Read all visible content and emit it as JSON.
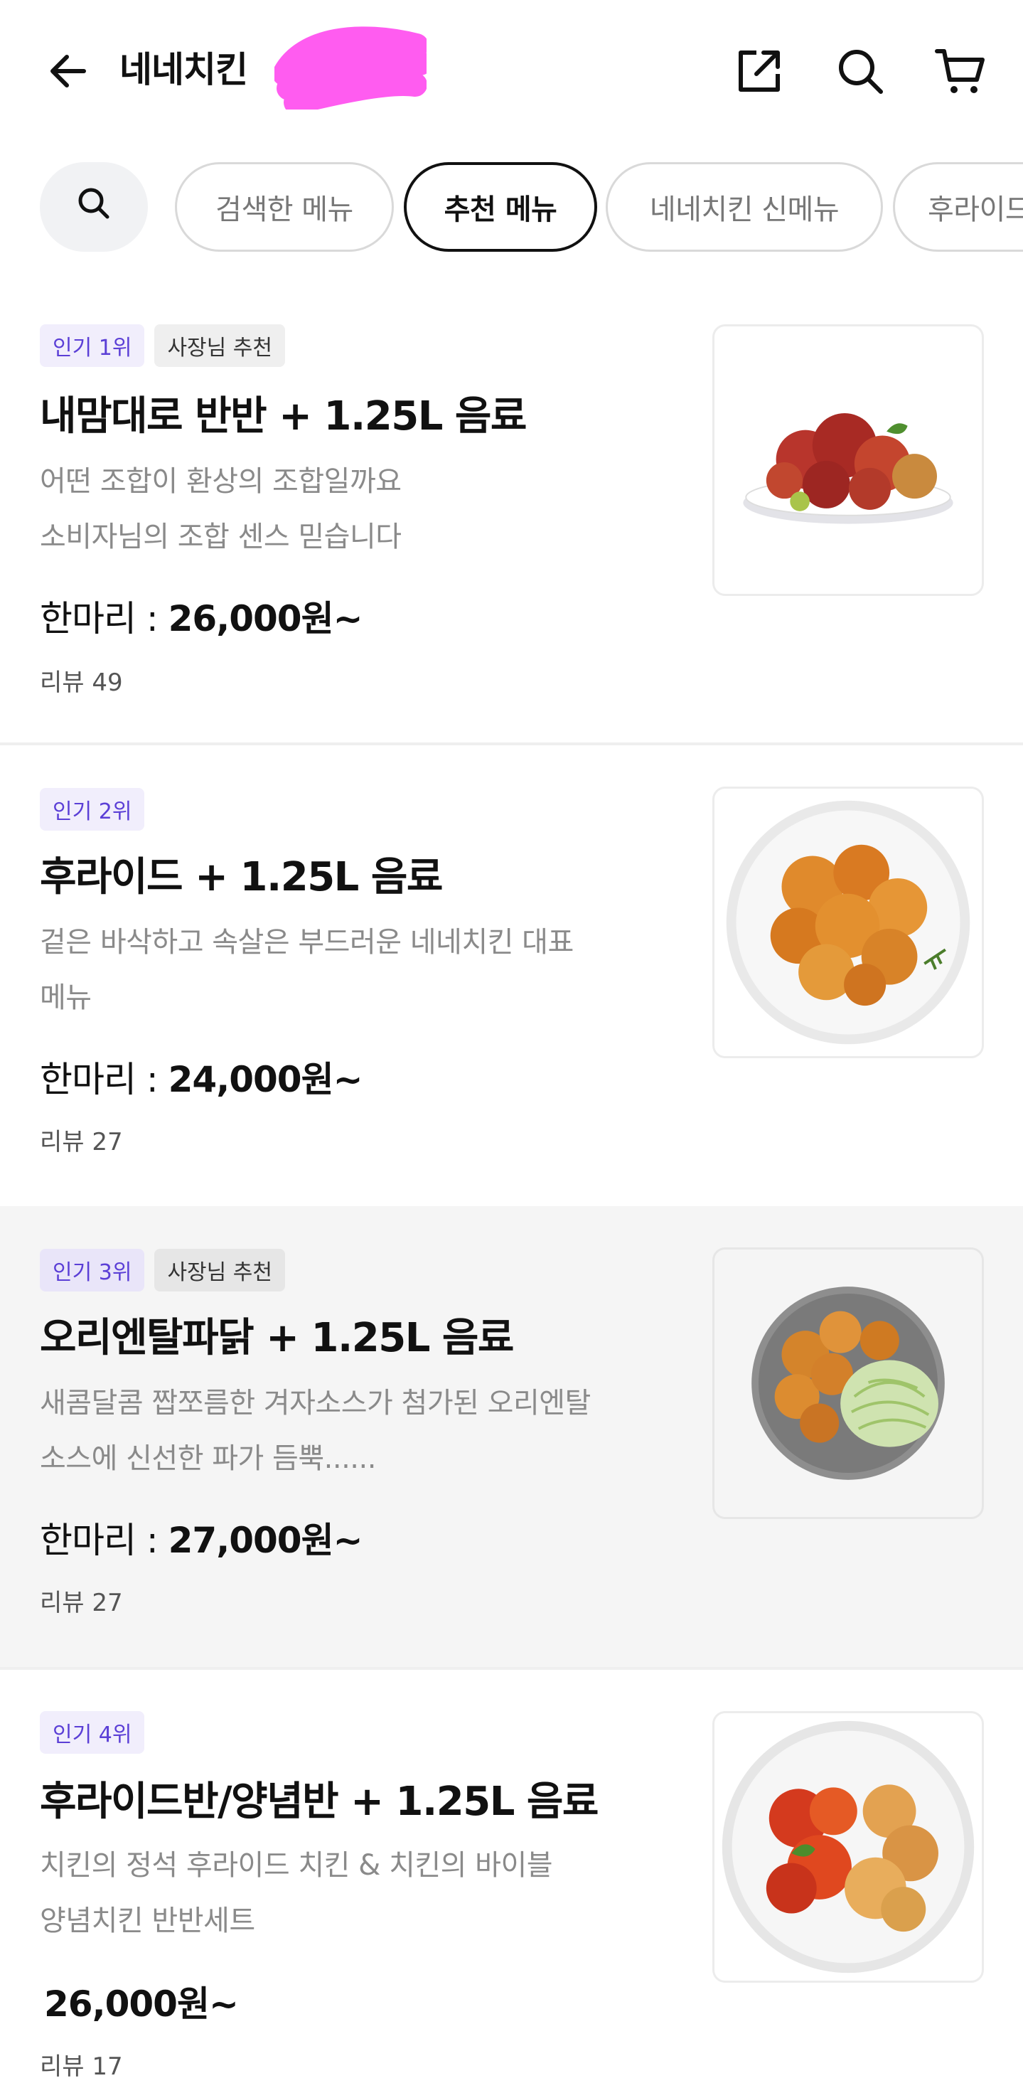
{
  "header": {
    "title": "네네치킨",
    "icons": [
      "back-arrow-icon",
      "share-icon",
      "search-icon",
      "cart-icon"
    ]
  },
  "chips": {
    "search_icon": "search-icon",
    "items": [
      {
        "label": "검색한 메뉴",
        "active": false
      },
      {
        "label": "추천 메뉴",
        "active": true
      },
      {
        "label": "네네치킨 신메뉴",
        "active": false
      },
      {
        "label": "후라이드",
        "active": false
      }
    ]
  },
  "menu": [
    {
      "rank_tag": "인기 1위",
      "owner_tag": "사장님 추천",
      "name": "내맘대로 반반 + 1.25L 음료",
      "desc_line1": "어떤 조합이 환상의 조합일까요",
      "desc_line2": "소비자님의 조합 센스 믿습니다",
      "price_label": "한마리 : ",
      "price": "26,000원~",
      "review": "리뷰 49",
      "image": "seasoned-chicken-plate"
    },
    {
      "rank_tag": "인기 2위",
      "owner_tag": "",
      "name": "후라이드 + 1.25L 음료",
      "desc_line1": "겉은 바삭하고 속살은 부드러운 네네치킨 대표",
      "desc_line2": "메뉴",
      "price_label": "한마리 : ",
      "price": "24,000원~",
      "review": "리뷰 27",
      "image": "fried-chicken-plate"
    },
    {
      "rank_tag": "인기 3위",
      "owner_tag": "사장님 추천",
      "name": "오리엔탈파닭 + 1.25L 음료",
      "desc_line1": "새콤달콤  짭쪼름한 겨자소스가 첨가된 오리엔탈",
      "desc_line2": "소스에 신선한 파가 듬뿍......",
      "price_label": "한마리 : ",
      "price": "27,000원~",
      "review": "리뷰 27",
      "image": "scallion-chicken-plate"
    },
    {
      "rank_tag": "인기 4위",
      "owner_tag": "",
      "name": "후라이드반/양념반 + 1.25L 음료",
      "desc_line1": "치킨의 정석 후라이드 치킨 & 치킨의 바이블",
      "desc_line2": "양념치킨 반반세트",
      "price_label": "",
      "price": "26,000원~",
      "review": "리뷰 17",
      "image": "half-half-chicken-plate"
    }
  ],
  "colors": {
    "accent": "#5b3fd6",
    "redaction": "#ff5cf0",
    "highlight_bg": "#f5f5f5"
  }
}
